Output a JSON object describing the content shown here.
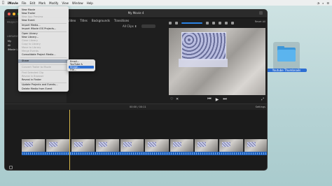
{
  "menubar": {
    "apple": "",
    "app": "iMovie",
    "items": [
      "File",
      "Edit",
      "Mark",
      "Modify",
      "View",
      "Window",
      "Help"
    ]
  },
  "desktop": {
    "folder_label": "Youtube Thumbnails"
  },
  "window": {
    "title": "My Movie 4",
    "tabs": [
      "Video",
      "Titles",
      "Backgrounds",
      "Transitions"
    ],
    "all_clips_label": "All Clips ⬍",
    "sidebar": {
      "section_libraries": "LIBRARIES",
      "projects_label": "PROJECT M",
      "items": [
        "My",
        "All",
        "iMovie L"
      ]
    },
    "viewer": {
      "reset_label": "Reset All"
    },
    "timeline": {
      "timecode": "00:00 / 00:11",
      "settings_label": "Settings"
    }
  },
  "file_menu": {
    "items": [
      {
        "label": "New Movie",
        "dim": false
      },
      {
        "label": "New Trailer",
        "dim": false
      },
      {
        "label": "New App Preview",
        "dim": true
      },
      {
        "label": "New Event",
        "dim": false
      },
      {
        "label": "Import Media...",
        "dim": false
      },
      {
        "label": "Import iMovie iOS Projects...",
        "dim": false
      },
      {
        "label": "Open Library",
        "dim": false
      },
      {
        "label": "New Library...",
        "dim": false
      },
      {
        "label": "Close Library",
        "dim": true
      },
      {
        "label": "Copy to Library",
        "dim": true
      },
      {
        "label": "Move to Library",
        "dim": true
      },
      {
        "label": "Merge Events",
        "dim": true
      },
      {
        "label": "Consolidate Project Media...",
        "dim": false
      },
      {
        "label": "Share",
        "dim": false
      },
      {
        "label": "Convert Trailer to Movie",
        "dim": true
      },
      {
        "label": "Find Selected Clip",
        "dim": true
      },
      {
        "label": "Reveal in Browser",
        "dim": true
      },
      {
        "label": "Reveal in Finder",
        "dim": false
      },
      {
        "label": "Update Projects and Events...",
        "dim": false
      },
      {
        "label": "Delete Media from Event",
        "dim": false
      }
    ]
  },
  "share_submenu": {
    "items": [
      "Email...",
      "YouTube & Facebook...",
      "Image...",
      "File..."
    ],
    "selected": "Image..."
  }
}
